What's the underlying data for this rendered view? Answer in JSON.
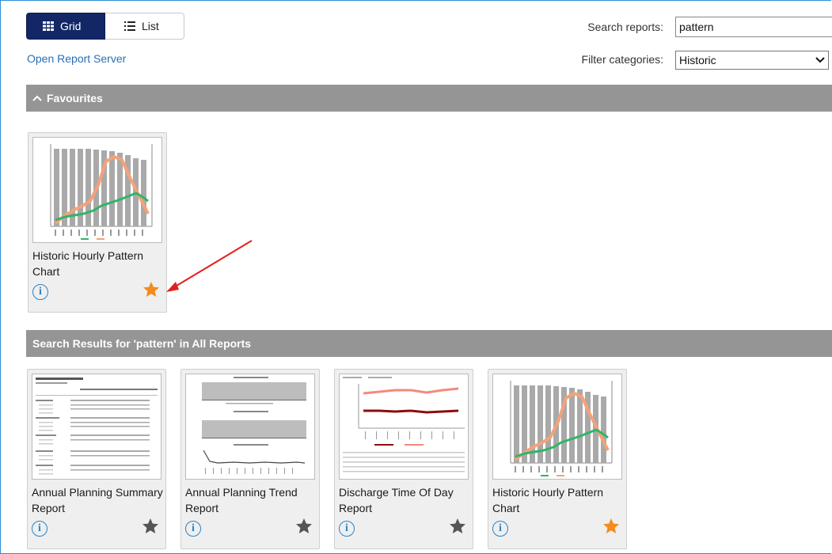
{
  "toolbar": {
    "grid_label": "Grid",
    "list_label": "List",
    "open_report_server": "Open Report Server"
  },
  "search": {
    "label": "Search reports:",
    "value": "pattern"
  },
  "filter": {
    "label": "Filter categories:",
    "selected": "Historic"
  },
  "favourites": {
    "header": "Favourites",
    "items": [
      {
        "title": "Historic Hourly Pattern Chart",
        "favourite": true
      }
    ]
  },
  "results": {
    "header": "Search Results for 'pattern' in All Reports",
    "items": [
      {
        "title": "Annual Planning Summary Report",
        "favourite": false
      },
      {
        "title": "Annual Planning Trend Report",
        "favourite": false
      },
      {
        "title": "Discharge Time Of Day Report",
        "favourite": false
      },
      {
        "title": "Historic Hourly Pattern Chart",
        "favourite": true
      }
    ]
  },
  "colors": {
    "accent": "#132766",
    "section": "#959595",
    "star_on": "#f28c1e",
    "star_off": "#555555",
    "link": "#2a6fb5",
    "annotation_arrow": "#e0201b"
  },
  "icons": [
    "grid-icon",
    "list-icon",
    "chevron-up-icon",
    "chevron-down-icon",
    "info-icon",
    "star-icon"
  ]
}
